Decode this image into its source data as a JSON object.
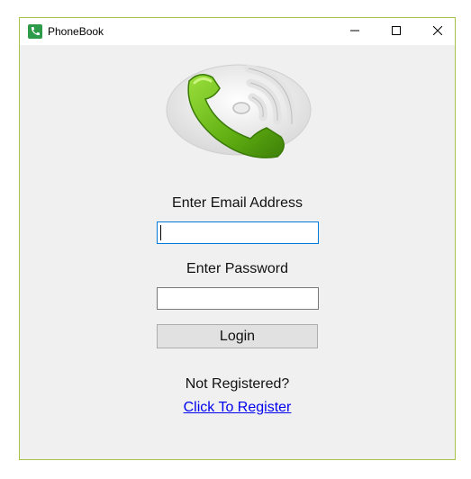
{
  "window": {
    "title": "PhoneBook",
    "border_color": "#a7c34a"
  },
  "icons": {
    "app": "phone-icon",
    "logo": "phone-logo",
    "minimize": "minimize-icon",
    "maximize": "maximize-icon",
    "close": "close-icon"
  },
  "form": {
    "email_label": "Enter Email Address",
    "email_value": "",
    "password_label": "Enter Password",
    "password_value": "",
    "login_label": "Login",
    "not_registered": "Not Registered?",
    "register_link": "Click To Register"
  },
  "colors": {
    "accent_green": "#6bb31a",
    "link_blue": "#0000ee",
    "focus_border": "#0078d7"
  }
}
